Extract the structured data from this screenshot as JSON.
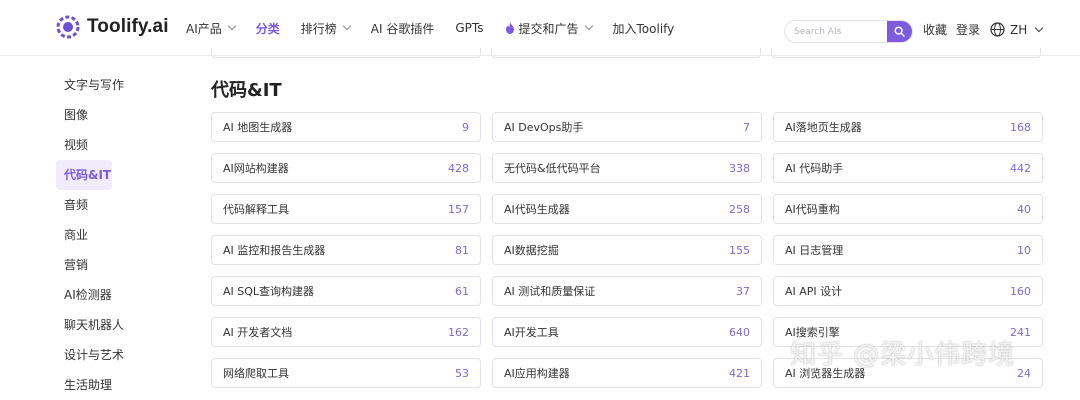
{
  "brand": {
    "name": "Toolify.ai",
    "accent": "#7c5cdc"
  },
  "nav": {
    "items": [
      {
        "label": "AI产品",
        "caret": true
      },
      {
        "label": "分类",
        "active": true
      },
      {
        "label": "排行榜",
        "caret": true
      },
      {
        "label": "AI 谷歌插件"
      },
      {
        "label": "GPTs"
      },
      {
        "label": "提交和广告",
        "caret": true,
        "icon": "fire-icon"
      },
      {
        "label": "加入Toolify"
      }
    ]
  },
  "search": {
    "placeholder": "Search AIs"
  },
  "header_links": {
    "favorites": "收藏",
    "login": "登录",
    "language": "ZH"
  },
  "sidebar": {
    "items": [
      {
        "label": "文字与写作"
      },
      {
        "label": "图像"
      },
      {
        "label": "视频"
      },
      {
        "label": "代码&IT",
        "active": true
      },
      {
        "label": "音频"
      },
      {
        "label": "商业"
      },
      {
        "label": "营销"
      },
      {
        "label": "AI检测器"
      },
      {
        "label": "聊天机器人"
      },
      {
        "label": "设计与艺术"
      },
      {
        "label": "生活助理"
      }
    ]
  },
  "section": {
    "title": "代码&IT",
    "cards": [
      {
        "name": "AI 地图生成器",
        "count": "9"
      },
      {
        "name": "AI DevOps助手",
        "count": "7"
      },
      {
        "name": "AI落地页生成器",
        "count": "168"
      },
      {
        "name": "AI网站构建器",
        "count": "428"
      },
      {
        "name": "无代码&低代码平台",
        "count": "338"
      },
      {
        "name": "AI 代码助手",
        "count": "442"
      },
      {
        "name": "代码解释工具",
        "count": "157"
      },
      {
        "name": "AI代码生成器",
        "count": "258"
      },
      {
        "name": "AI代码重构",
        "count": "40"
      },
      {
        "name": "AI 监控和报告生成器",
        "count": "81"
      },
      {
        "name": "AI数据挖掘",
        "count": "155"
      },
      {
        "name": "AI 日志管理",
        "count": "10"
      },
      {
        "name": "AI SQL查询构建器",
        "count": "61"
      },
      {
        "name": "AI 测试和质量保证",
        "count": "37"
      },
      {
        "name": "AI API 设计",
        "count": "160"
      },
      {
        "name": "AI 开发者文档",
        "count": "162"
      },
      {
        "name": "AI开发工具",
        "count": "640"
      },
      {
        "name": "AI搜索引擎",
        "count": "241"
      },
      {
        "name": "网络爬取工具",
        "count": "53"
      },
      {
        "name": "AI应用构建器",
        "count": "421"
      },
      {
        "name": "AI 浏览器生成器",
        "count": "24"
      }
    ]
  },
  "watermark": {
    "text": "知乎 @梁小伟跨境"
  }
}
